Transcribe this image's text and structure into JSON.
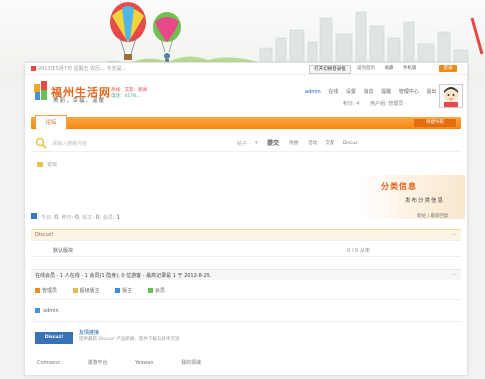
{
  "topbar": {
    "left_text": "2013年5月7日 星期五 农历... 今天是...",
    "mark_btn": "打开切换登录框",
    "links": [
      "设为首页",
      "收藏",
      "手机版"
    ],
    "right_btn": "登录"
  },
  "brand": {
    "name": "福州生活网",
    "slogan": "美丽，幸福，温暖",
    "hotline_1": "热线：交友：新闻",
    "hotline_2": "电话：4178...."
  },
  "user": {
    "username": "admin",
    "links": [
      "在线",
      "设置",
      "消息",
      "提醒",
      "管理中心",
      "退出"
    ],
    "row2": [
      "积分: 4",
      "用户组: 管理员"
    ]
  },
  "nav": {
    "home_tab": "论坛",
    "right_btn": "快捷导航"
  },
  "search": {
    "placeholder": "请输入搜索内容",
    "type_label": "帖子",
    "type_select": "▾",
    "submit": "提交",
    "hot_links": [
      "热搜:",
      "活动",
      "交友",
      "Discuz"
    ]
  },
  "breadcrumb": "论坛",
  "category": {
    "title": "分类信息",
    "subtitle": "发布分类信息"
  },
  "stats": {
    "prefix": "今日:",
    "today": "0",
    "mid1": "昨日:",
    "yesterday": "0",
    "mid2": "帖子:",
    "posts": "0",
    "mid3": "会员:",
    "members": "1",
    "right": "新帖 | 最新回复"
  },
  "forum_section": {
    "title": "Discuz!",
    "collapse": "—",
    "row_name": "默认版块",
    "row_info": "0 / 0    从未"
  },
  "online": {
    "title": "在线会员 - 1 人在线 - 1 会员(1 隐身), 0 位游客 - 最高记录是 1 于 2012-8-25.",
    "collapse": "—",
    "legend": [
      "管理员",
      "超级版主",
      "版主",
      "会员"
    ],
    "legend_colors": [
      "#f08a1c",
      "#e4b84a",
      "#3a8ce0",
      "#6cbf55"
    ],
    "user": "admin"
  },
  "friend_links": {
    "banner": "Discuz!",
    "title": "友情链接",
    "desc": "提供最新 Discuz! 产品新闻、软件下载与技术交流",
    "items": [
      "Comsenz",
      "漫游平台",
      "Yeswan",
      "我的领域"
    ]
  }
}
